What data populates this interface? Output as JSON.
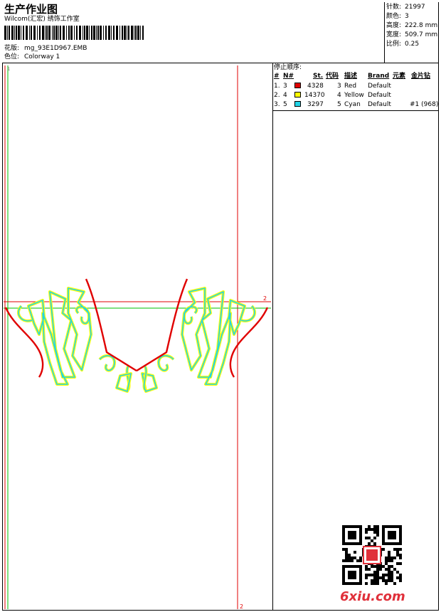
{
  "header": {
    "title": "生产作业图",
    "company": "Wilcom(汇宏) 绣饰工作室",
    "design_label": "花版:",
    "design_file": "mg_93E1D967.EMB",
    "colorway_label": "色位:",
    "colorway": "Colorway 1"
  },
  "stats": {
    "stitches_label": "针数:",
    "stitches": "21997",
    "colors_label": "颜色:",
    "colors": "3",
    "height_label": "高度:",
    "height": "222.8 mm",
    "width_label": "宽度:",
    "width": "509.7 mm",
    "scale_label": "比例:",
    "scale": "0.25"
  },
  "stop_sequence": {
    "label": "停止顺序:",
    "columns": [
      "#",
      "N#",
      "St.",
      "代码",
      "描述",
      "Brand",
      "元素",
      "金片钻"
    ],
    "rows": [
      {
        "index": "1.",
        "n": "3",
        "color": "#e00000",
        "stitches": "4328",
        "code": "3",
        "desc": "Red",
        "brand": "Default",
        "elements": "",
        "sequin": ""
      },
      {
        "index": "2.",
        "n": "4",
        "color": "#ffff00",
        "stitches": "14370",
        "code": "4",
        "desc": "Yellow",
        "brand": "Default",
        "elements": "",
        "sequin": ""
      },
      {
        "index": "3.",
        "n": "5",
        "color": "#22d3e6",
        "stitches": "3297",
        "code": "5",
        "desc": "Cyan",
        "brand": "Default",
        "elements": "",
        "sequin": "#1 (968)"
      }
    ]
  },
  "canvas": {
    "axis_marker_top": "1",
    "axis_marker_right": "2",
    "axis_marker_bottom": "2"
  },
  "watermark": {
    "site": "6xiu.com",
    "colors": {
      "site_text": "#e0303a"
    }
  },
  "colors": {
    "red_guide": "#e00000",
    "green_guide": "#00c000",
    "outline_red": "#e00000",
    "outline_yellow": "#ffff00",
    "outline_cyan": "#22d3e6"
  }
}
